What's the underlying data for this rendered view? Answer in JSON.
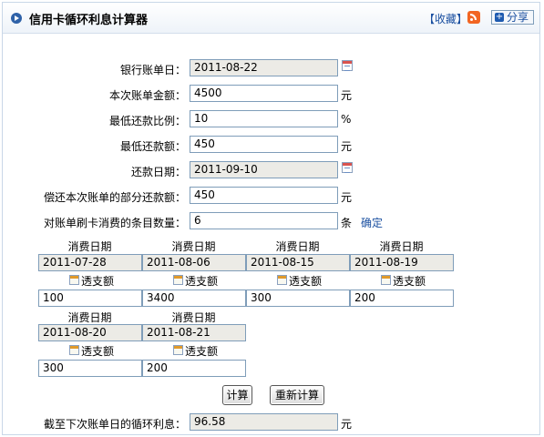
{
  "header": {
    "title": "信用卡循环利息计算器",
    "favorite_label": "【收藏】",
    "share_label": "分享"
  },
  "form": {
    "statement_date": {
      "label": "银行账单日：",
      "value": "2011-08-22"
    },
    "bill_amount": {
      "label": "本次账单金额：",
      "value": "4500",
      "unit": "元"
    },
    "min_payment_ratio": {
      "label": "最低还款比例：",
      "value": "10",
      "unit": "%"
    },
    "min_payment": {
      "label": "最低还款额：",
      "value": "450",
      "unit": "元"
    },
    "payment_date": {
      "label": "还款日期：",
      "value": "2011-09-10"
    },
    "partial_payment": {
      "label": "偿还本次账单的部分还款额：",
      "value": "450",
      "unit": "元"
    },
    "item_count": {
      "label": "对账单刷卡消费的条目数量：",
      "value": "6",
      "unit": "条",
      "confirm_label": "确定"
    }
  },
  "entries": {
    "date_header": "消费日期",
    "overdraft_label": "透支额",
    "rows": [
      [
        {
          "date": "2011-07-28",
          "amount": "100"
        },
        {
          "date": "2011-08-06",
          "amount": "3400"
        },
        {
          "date": "2011-08-15",
          "amount": "300"
        },
        {
          "date": "2011-08-19",
          "amount": "200"
        }
      ],
      [
        {
          "date": "2011-08-20",
          "amount": "300"
        },
        {
          "date": "2011-08-21",
          "amount": "200"
        }
      ]
    ]
  },
  "actions": {
    "calculate_label": "计算",
    "recalculate_label": "重新计算"
  },
  "result": {
    "label": "截至下次账单日的循环利息：",
    "value": "96.58",
    "unit": "元"
  }
}
